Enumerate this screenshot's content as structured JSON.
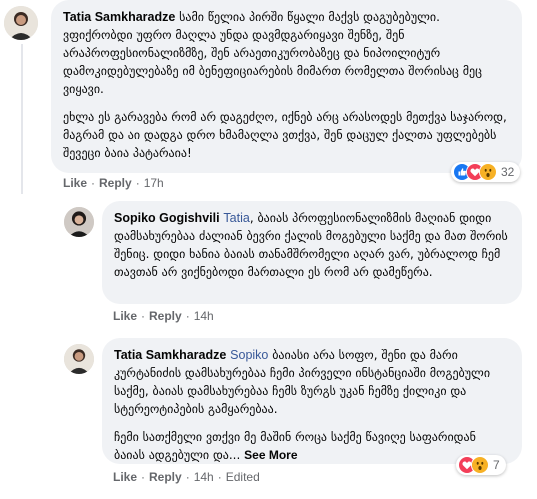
{
  "comments": [
    {
      "author": "Tatia Samkharadze",
      "paragraphs": [
        "სამი წელია პირში წყალი მაქვს დაგუბებული. ვფიქრობდი უფრო მაღლა უნდა დავმდგარიყავი შენზე, შენ არაპროფესიონალიზმზე, შენ არაეთიკურობაზეც და ნიპოილიტურ დამოკიდებულებაზე იმ ბენეფიციარების მიმართ რომელთა შორისაც მეც ვიყავი.",
        "ეხლა ეს გარავება რომ არ დაგეძღო, იქნებ არც არასოდეს მეთქვა საჯაროდ, მაგრამ და აი დადგა დრო ხმამაღლა ვთქვა, შენ დაცულ ქალთა უფლებებს შევეცი ბაია პატარაია!"
      ],
      "actions": {
        "like": "Like",
        "reply": "Reply",
        "time": "17h"
      },
      "reactions": {
        "icons": [
          "like-icon",
          "love-icon",
          "wow-icon"
        ],
        "count": "32"
      }
    },
    {
      "author": "Sopiko Gogishvili",
      "mention": "Tatia",
      "body": "ბაიას პროფესიონალიზმის მაღიან დიდი დამსახურებაა ძალიან ბევრი ქალის მოგებული საქმე და მათ შორის შენიც. დიდი ხანია ბაიას თანამშრომელი აღარ ვარ, უბრალოდ ჩემ თავთან არ ვიქნებოდი მართალი ეს რომ არ დამეწერა.",
      "actions": {
        "like": "Like",
        "reply": "Reply",
        "time": "14h"
      }
    },
    {
      "author": "Tatia Samkharadze",
      "mention": "Sopiko",
      "paragraphs": [
        "ბაიასი არა სოფო, შენი და მარი კურტანიძის დამსახურებაა ჩემი პირველი ინსტანციაში მოგებული საქმე, ბაიას დამსახურებაა ჩემს ზურგს უკან ჩემზე ქილიკი და სტერეოტიპების გამყარებაა.",
        "ჩემი სათქმელი ვთქვი მე მაშინ როცა საქმე წავიღე საფარიდან ბაიას ადგებული და..."
      ],
      "see_more": "See More",
      "actions": {
        "like": "Like",
        "reply": "Reply",
        "time": "14h",
        "edited": "Edited"
      },
      "reactions": {
        "icons": [
          "love-icon",
          "wow-icon"
        ],
        "count": "7"
      }
    }
  ],
  "colors": {
    "bubble": "#f0f2f5",
    "mention": "#385898",
    "meta": "#65676b",
    "like": "#1877f2",
    "love": "#f33e58",
    "wow": "#f7b125"
  }
}
